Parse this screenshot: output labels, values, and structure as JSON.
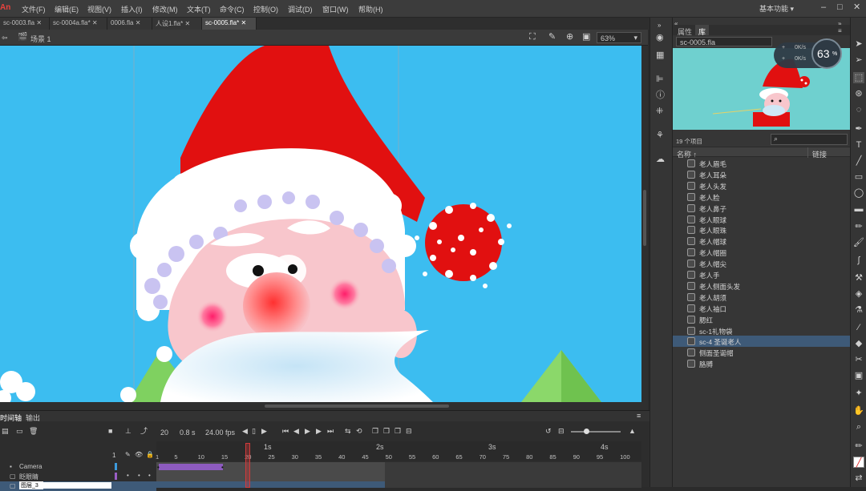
{
  "app": {
    "logo": "An"
  },
  "menu": [
    "文件(F)",
    "编辑(E)",
    "视图(V)",
    "插入(I)",
    "修改(M)",
    "文本(T)",
    "命令(C)",
    "控制(O)",
    "调试(D)",
    "窗口(W)",
    "帮助(H)"
  ],
  "workspace": "基本功能",
  "doc_tabs": [
    "sc-0003.fla",
    "sc-0004a.fla*",
    "0006.fla",
    "人设1.fla*",
    "sc-0005.fla*"
  ],
  "scene": {
    "name": "场景 1",
    "zoom": "63%"
  },
  "panel_tabs": {
    "properties": "属性",
    "library": "库"
  },
  "library": {
    "doc_name": "sc-0005.fla",
    "count": "19 个项目",
    "col_name": "名称 ↑",
    "col_link": "链接",
    "items": [
      "老人眉毛",
      "老人耳朵",
      "老人头发",
      "老人脸",
      "老人鼻子",
      "老人眼球",
      "老人眼珠",
      "老人帽球",
      "老人帽圈",
      "老人帽尖",
      "老人手",
      "老人侧面头发",
      "老人胡须",
      "老人袖口",
      "腮红",
      "sc-1礼物袋",
      "sc-4 圣诞老人",
      "侧面圣诞帽",
      "胳膊"
    ],
    "selected_index": 16
  },
  "perf": {
    "percent": "63",
    "unit": "%",
    "up": "0K/s",
    "down": "0K/s"
  },
  "timeline": {
    "tabs": [
      "时间轴",
      "输出"
    ],
    "frame": "20",
    "time": "0.8 s",
    "fps": "24.00 fps",
    "seconds": [
      "1s",
      "2s",
      "3s",
      "4s"
    ],
    "frame_ticks": [
      "1",
      "5",
      "10",
      "15",
      "20",
      "25",
      "30",
      "35",
      "40",
      "45",
      "50",
      "55",
      "60",
      "65",
      "70",
      "75",
      "80",
      "85",
      "90",
      "95",
      "100"
    ],
    "layers": [
      "Camera",
      "眨眼睛",
      "图层_3"
    ]
  },
  "colors": {
    "stage_bg": "#3cbdf0",
    "hat_red": "#e11010",
    "accent_playhead": "#d23a3a"
  }
}
